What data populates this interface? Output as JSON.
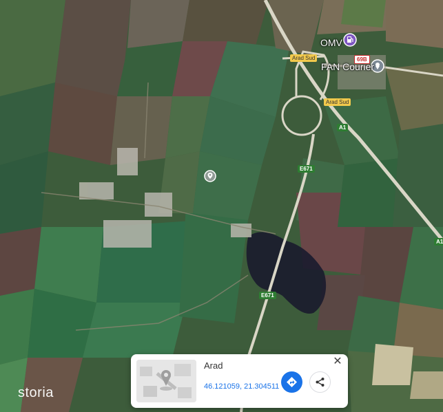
{
  "map": {
    "type": "satellite",
    "pois": [
      {
        "label": "OMV",
        "icon": "fuel-station-icon"
      },
      {
        "label": "FAN Courier",
        "icon": "place-pin-icon"
      }
    ],
    "road_labels": {
      "exit_1": "Arad Sud",
      "exit_2": "Arad Sud",
      "route_69": "69B",
      "a1_1": "A1",
      "a1_2": "A1",
      "e671_1": "E671",
      "e671_2": "E671"
    },
    "location_pin_icon": "location-pin-icon"
  },
  "watermark": "storia",
  "info_card": {
    "title": "Arad",
    "coordinates": "46.121059, 21.304511",
    "thumbnail": "street-view-thumbnail",
    "directions_icon": "directions-icon",
    "share_icon": "share-icon",
    "close_icon": "close-icon"
  },
  "colors": {
    "accent_blue": "#1a73e8",
    "exit_label": "#f2c94c",
    "motorway_label": "#2e7d32"
  }
}
